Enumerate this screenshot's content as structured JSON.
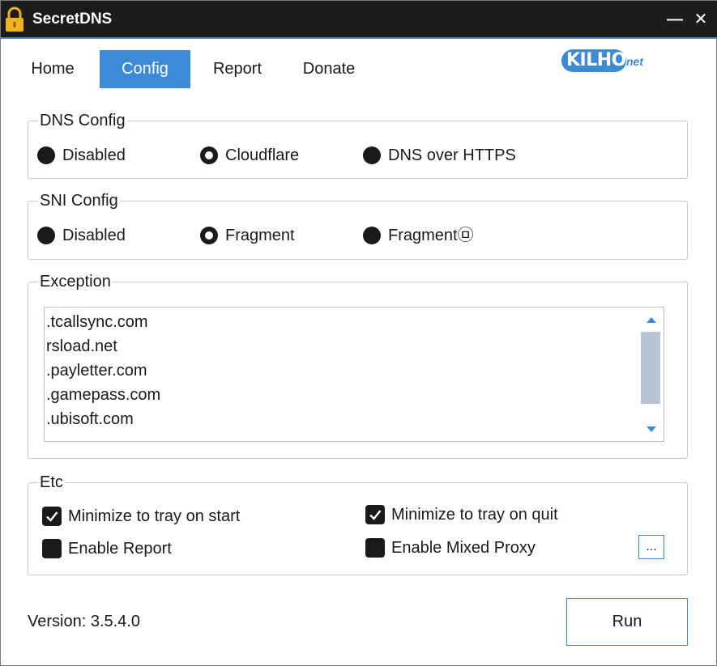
{
  "window": {
    "title": "SecretDNS",
    "minimize": "—",
    "close": "✕"
  },
  "tabs": [
    {
      "label": "Home"
    },
    {
      "label": "Config",
      "active": true
    },
    {
      "label": "Report"
    },
    {
      "label": "Donate"
    }
  ],
  "logo": {
    "main": "KILHO",
    "suffix": "net"
  },
  "dns_config": {
    "title": "DNS Config",
    "options": [
      {
        "label": "Disabled",
        "checked": false
      },
      {
        "label": "Cloudflare",
        "checked": true
      },
      {
        "label": "DNS over HTTPS",
        "checked": false
      }
    ]
  },
  "sni_config": {
    "title": "SNI Config",
    "options": [
      {
        "label": "Disabled",
        "checked": false
      },
      {
        "label": "Fragment",
        "checked": true
      },
      {
        "label": "Fragment㉤",
        "checked": false
      }
    ]
  },
  "exception": {
    "title": "Exception",
    "items": [
      ".tcallsync.com",
      "rsload.net",
      ".payletter.com",
      ".gamepass.com",
      ".ubisoft.com"
    ]
  },
  "etc": {
    "title": "Etc",
    "minimize_on_start": {
      "label": "Minimize to tray on start",
      "checked": true
    },
    "minimize_on_quit": {
      "label": "Minimize to tray on quit",
      "checked": true
    },
    "enable_report": {
      "label": "Enable Report",
      "checked": false
    },
    "enable_mixed_proxy": {
      "label": "Enable Mixed Proxy",
      "checked": false
    },
    "more_button": "..."
  },
  "footer": {
    "version": "Version: 3.5.4.0",
    "run_label": "Run"
  },
  "colors": {
    "accent": "#3c8ad6",
    "titlebar": "#1c1c1c",
    "lock": "#f2b120"
  }
}
